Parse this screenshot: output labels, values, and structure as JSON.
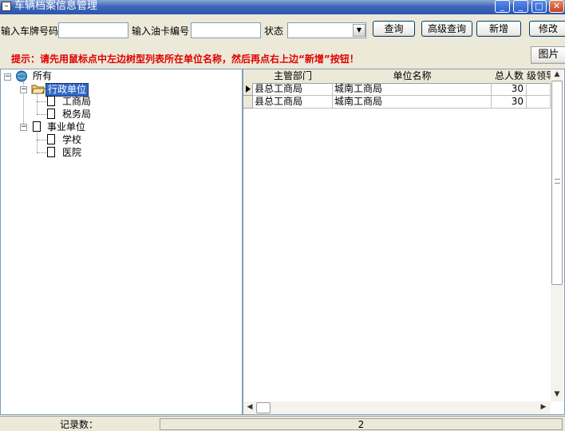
{
  "window": {
    "title": "车辆档案信息管理",
    "min_glyph": "_",
    "max_glyph": "□",
    "close_glyph": "✕"
  },
  "toolbar": {
    "plate_label": "输入车牌号码",
    "plate_value": "",
    "card_label": "输入油卡编号",
    "card_value": "",
    "status_label": "状态",
    "status_value": "",
    "query_label": "查询",
    "advanced_query_label": "高级查询",
    "add_label": "新增",
    "edit_label": "修改",
    "picture_label": "图片"
  },
  "hint": "提示：请先用鼠标点中左边树型列表所在单位名称，然后再点右上边“新增”按钮！",
  "tree": {
    "root": "所有",
    "nodes": [
      {
        "label": "行政单位",
        "selected": true,
        "children": [
          "工商局",
          "税务局"
        ]
      },
      {
        "label": "事业单位",
        "selected": false,
        "children": [
          "学校",
          "医院"
        ]
      }
    ]
  },
  "grid": {
    "columns": [
      "主管部门",
      "单位名称",
      "总人数",
      "级领导"
    ],
    "rows": [
      {
        "dept": "县总工商局",
        "unit": "城南工商局",
        "count": "30"
      },
      {
        "dept": "县总工商局",
        "unit": "城南工商局",
        "count": "30"
      }
    ]
  },
  "statusbar": {
    "label": "记录数：",
    "count": "2"
  },
  "colors": {
    "hint": "#e00000",
    "selection": "#316ac5",
    "titlebar": "#2a55b0"
  }
}
